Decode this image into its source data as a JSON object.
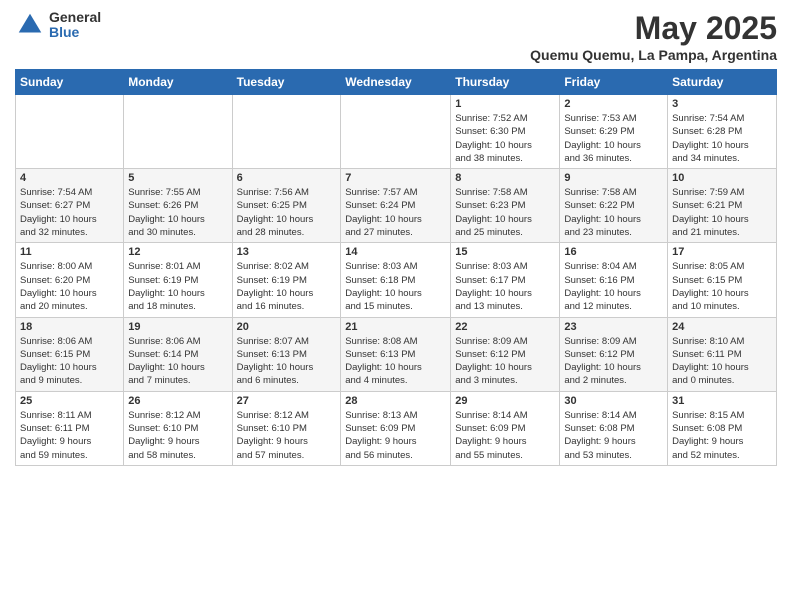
{
  "header": {
    "logo_general": "General",
    "logo_blue": "Blue",
    "month_title": "May 2025",
    "location": "Quemu Quemu, La Pampa, Argentina"
  },
  "days_of_week": [
    "Sunday",
    "Monday",
    "Tuesday",
    "Wednesday",
    "Thursday",
    "Friday",
    "Saturday"
  ],
  "weeks": [
    [
      {
        "day": "",
        "content": ""
      },
      {
        "day": "",
        "content": ""
      },
      {
        "day": "",
        "content": ""
      },
      {
        "day": "",
        "content": ""
      },
      {
        "day": "1",
        "content": "Sunrise: 7:52 AM\nSunset: 6:30 PM\nDaylight: 10 hours\nand 38 minutes."
      },
      {
        "day": "2",
        "content": "Sunrise: 7:53 AM\nSunset: 6:29 PM\nDaylight: 10 hours\nand 36 minutes."
      },
      {
        "day": "3",
        "content": "Sunrise: 7:54 AM\nSunset: 6:28 PM\nDaylight: 10 hours\nand 34 minutes."
      }
    ],
    [
      {
        "day": "4",
        "content": "Sunrise: 7:54 AM\nSunset: 6:27 PM\nDaylight: 10 hours\nand 32 minutes."
      },
      {
        "day": "5",
        "content": "Sunrise: 7:55 AM\nSunset: 6:26 PM\nDaylight: 10 hours\nand 30 minutes."
      },
      {
        "day": "6",
        "content": "Sunrise: 7:56 AM\nSunset: 6:25 PM\nDaylight: 10 hours\nand 28 minutes."
      },
      {
        "day": "7",
        "content": "Sunrise: 7:57 AM\nSunset: 6:24 PM\nDaylight: 10 hours\nand 27 minutes."
      },
      {
        "day": "8",
        "content": "Sunrise: 7:58 AM\nSunset: 6:23 PM\nDaylight: 10 hours\nand 25 minutes."
      },
      {
        "day": "9",
        "content": "Sunrise: 7:58 AM\nSunset: 6:22 PM\nDaylight: 10 hours\nand 23 minutes."
      },
      {
        "day": "10",
        "content": "Sunrise: 7:59 AM\nSunset: 6:21 PM\nDaylight: 10 hours\nand 21 minutes."
      }
    ],
    [
      {
        "day": "11",
        "content": "Sunrise: 8:00 AM\nSunset: 6:20 PM\nDaylight: 10 hours\nand 20 minutes."
      },
      {
        "day": "12",
        "content": "Sunrise: 8:01 AM\nSunset: 6:19 PM\nDaylight: 10 hours\nand 18 minutes."
      },
      {
        "day": "13",
        "content": "Sunrise: 8:02 AM\nSunset: 6:19 PM\nDaylight: 10 hours\nand 16 minutes."
      },
      {
        "day": "14",
        "content": "Sunrise: 8:03 AM\nSunset: 6:18 PM\nDaylight: 10 hours\nand 15 minutes."
      },
      {
        "day": "15",
        "content": "Sunrise: 8:03 AM\nSunset: 6:17 PM\nDaylight: 10 hours\nand 13 minutes."
      },
      {
        "day": "16",
        "content": "Sunrise: 8:04 AM\nSunset: 6:16 PM\nDaylight: 10 hours\nand 12 minutes."
      },
      {
        "day": "17",
        "content": "Sunrise: 8:05 AM\nSunset: 6:15 PM\nDaylight: 10 hours\nand 10 minutes."
      }
    ],
    [
      {
        "day": "18",
        "content": "Sunrise: 8:06 AM\nSunset: 6:15 PM\nDaylight: 10 hours\nand 9 minutes."
      },
      {
        "day": "19",
        "content": "Sunrise: 8:06 AM\nSunset: 6:14 PM\nDaylight: 10 hours\nand 7 minutes."
      },
      {
        "day": "20",
        "content": "Sunrise: 8:07 AM\nSunset: 6:13 PM\nDaylight: 10 hours\nand 6 minutes."
      },
      {
        "day": "21",
        "content": "Sunrise: 8:08 AM\nSunset: 6:13 PM\nDaylight: 10 hours\nand 4 minutes."
      },
      {
        "day": "22",
        "content": "Sunrise: 8:09 AM\nSunset: 6:12 PM\nDaylight: 10 hours\nand 3 minutes."
      },
      {
        "day": "23",
        "content": "Sunrise: 8:09 AM\nSunset: 6:12 PM\nDaylight: 10 hours\nand 2 minutes."
      },
      {
        "day": "24",
        "content": "Sunrise: 8:10 AM\nSunset: 6:11 PM\nDaylight: 10 hours\nand 0 minutes."
      }
    ],
    [
      {
        "day": "25",
        "content": "Sunrise: 8:11 AM\nSunset: 6:11 PM\nDaylight: 9 hours\nand 59 minutes."
      },
      {
        "day": "26",
        "content": "Sunrise: 8:12 AM\nSunset: 6:10 PM\nDaylight: 9 hours\nand 58 minutes."
      },
      {
        "day": "27",
        "content": "Sunrise: 8:12 AM\nSunset: 6:10 PM\nDaylight: 9 hours\nand 57 minutes."
      },
      {
        "day": "28",
        "content": "Sunrise: 8:13 AM\nSunset: 6:09 PM\nDaylight: 9 hours\nand 56 minutes."
      },
      {
        "day": "29",
        "content": "Sunrise: 8:14 AM\nSunset: 6:09 PM\nDaylight: 9 hours\nand 55 minutes."
      },
      {
        "day": "30",
        "content": "Sunrise: 8:14 AM\nSunset: 6:08 PM\nDaylight: 9 hours\nand 53 minutes."
      },
      {
        "day": "31",
        "content": "Sunrise: 8:15 AM\nSunset: 6:08 PM\nDaylight: 9 hours\nand 52 minutes."
      }
    ]
  ]
}
